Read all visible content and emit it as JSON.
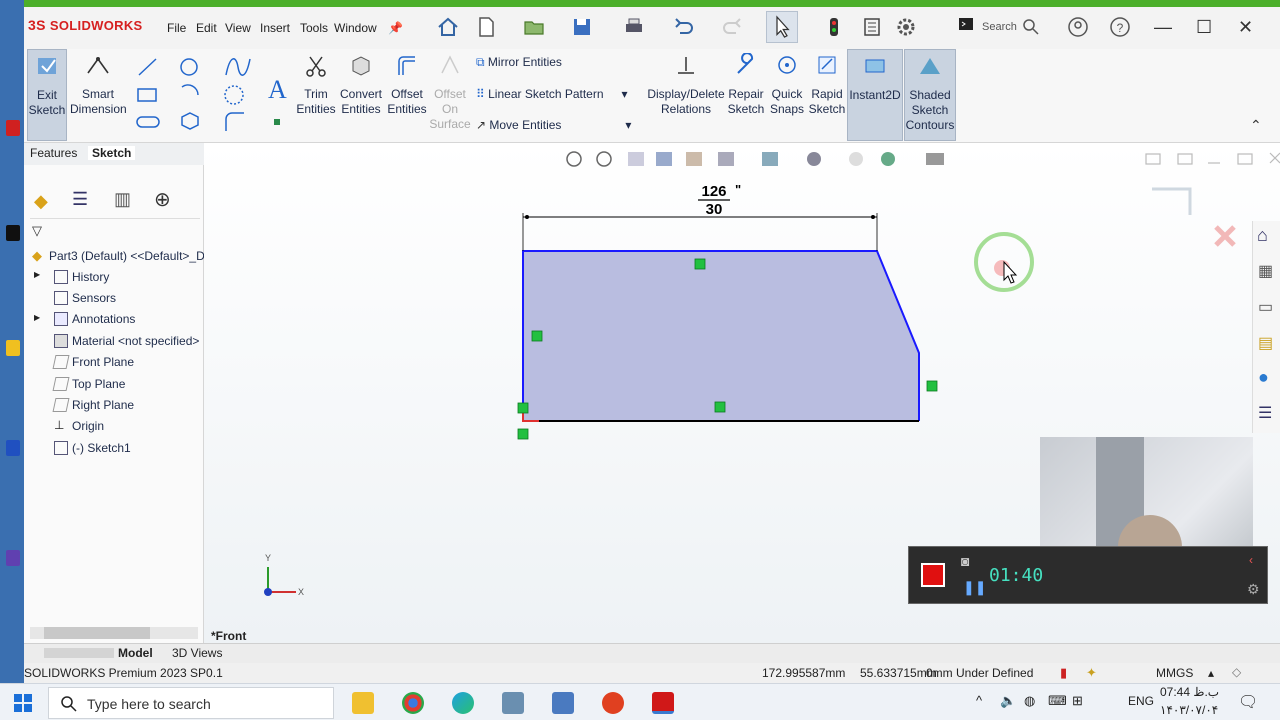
{
  "app": {
    "logo": "SOLIDWORKS",
    "menu": [
      "File",
      "Edit",
      "View",
      "Insert",
      "Tools",
      "Window"
    ],
    "search_placeholder": "Search",
    "version": "SOLIDWORKS Premium 2023 SP0.1"
  },
  "ribbon": {
    "exit_sketch": "Exit\nSketch",
    "smart_dimension": "Smart\nDimension",
    "trim_entities": "Trim\nEntities",
    "convert_entities": "Convert\nEntities",
    "offset_entities": "Offset\nEntities",
    "offset_on_surface": "Offset\nOn\nSurface",
    "mirror_entities": "Mirror Entities",
    "linear_sketch_pattern": "Linear Sketch Pattern",
    "move_entities": "Move Entities",
    "display_delete_relations": "Display/Delete\nRelations",
    "repair_sketch": "Repair\nSketch",
    "quick_snaps": "Quick\nSnaps",
    "rapid_sketch": "Rapid\nSketch",
    "instant2d": "Instant2D",
    "shaded_sketch_contours": "Shaded\nSketch\nContours"
  },
  "manager_tabs": [
    "Features",
    "Sketch"
  ],
  "tree": {
    "root": "Part3 (Default) <<Default>_D",
    "items": [
      "History",
      "Sensors",
      "Annotations",
      "Material <not specified>",
      "Front Plane",
      "Top Plane",
      "Right Plane",
      "Origin",
      "(-) Sketch1"
    ]
  },
  "viewport": {
    "dimension_whole": "126",
    "dimension_fraction": "30",
    "dimension_unit": "\"",
    "view_label": "*Front"
  },
  "bottom_tabs": [
    "Model",
    "3D Views"
  ],
  "status": {
    "x_coord": "172.995587mm",
    "y_coord": "55.633715mm",
    "z_and_state": "0mm Under Defined",
    "units": "MMGS"
  },
  "recorder": {
    "timer": "01:40"
  },
  "taskbar": {
    "search_placeholder": "Type here to search",
    "lang": "ENG",
    "time": "07:44 ب.ظ",
    "date": "۱۴۰۳/۰۷/۰۴"
  },
  "colors": {
    "accent_green": "#4caf2a",
    "sketch_fill": "#b9bde0",
    "sketch_line": "#1a1aff",
    "relation_green": "#22c040",
    "logo_red": "#d62020"
  }
}
